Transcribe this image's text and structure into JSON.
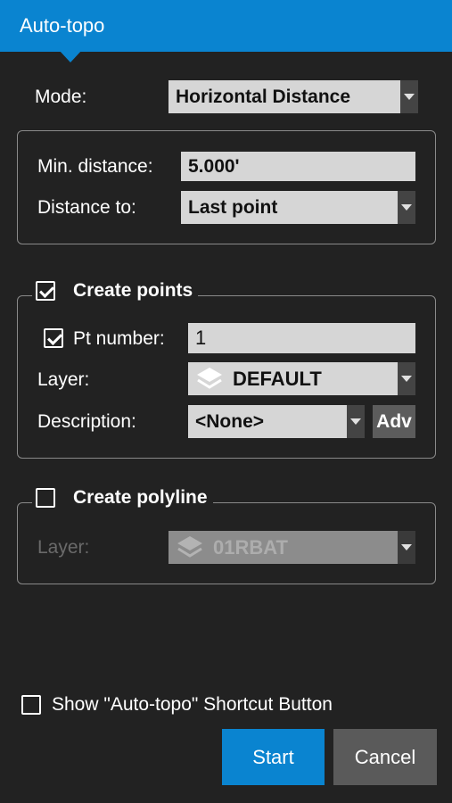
{
  "window": {
    "title": "Auto-topo"
  },
  "mode": {
    "label": "Mode:",
    "value": "Horizontal Distance"
  },
  "distance": {
    "min_label": "Min. distance:",
    "min_value": "5.000'",
    "to_label": "Distance to:",
    "to_value": "Last point"
  },
  "create_points": {
    "label": "Create points",
    "checked": true,
    "pt_number_label": "Pt number:",
    "pt_number_checked": true,
    "pt_number_value": "1",
    "layer_label": "Layer:",
    "layer_value": "DEFAULT",
    "description_label": "Description:",
    "description_value": "<None>",
    "adv_label": "Adv"
  },
  "create_polyline": {
    "label": "Create polyline",
    "checked": false,
    "layer_label": "Layer:",
    "layer_value": "01RBAT"
  },
  "shortcut": {
    "label": "Show \"Auto-topo\" Shortcut Button",
    "checked": false
  },
  "buttons": {
    "start": "Start",
    "cancel": "Cancel"
  },
  "colors": {
    "accent": "#0a84d0",
    "background": "#222222",
    "field": "#d6d6d6",
    "cancel": "#5a5a5a"
  }
}
